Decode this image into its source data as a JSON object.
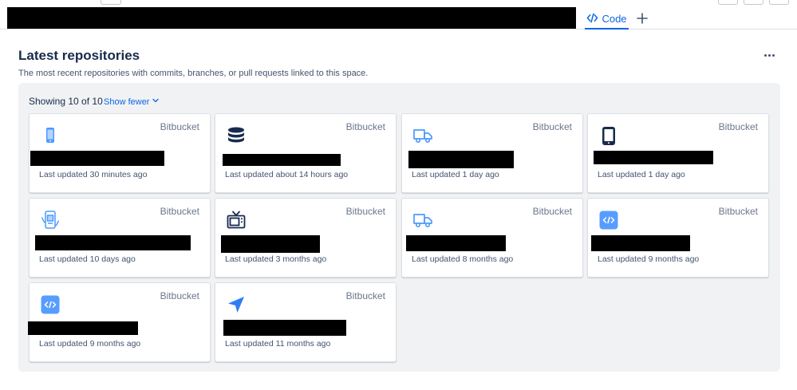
{
  "header": {
    "tabs": [
      {
        "label": "Code",
        "icon": "code-icon",
        "active": true
      }
    ],
    "add_tab_icon": "plus-icon"
  },
  "section": {
    "title": "Latest repositories",
    "description": "The most recent repositories with commits, branches, or pull requests linked to this space.",
    "more_icon": "more-horizontal-icon",
    "showing": "Showing 10 of 10",
    "show_fewer": "Show fewer"
  },
  "colors": {
    "accent": "#0c66e4",
    "panel_bg": "#f1f2f4",
    "icon_blue": "#4c9aff",
    "redaction": "#000000"
  },
  "repositories": [
    {
      "provider": "Bitbucket",
      "icon": "mobile-phone-icon",
      "updated": "Last updated 30 minutes ago"
    },
    {
      "provider": "Bitbucket",
      "icon": "database-icon",
      "updated": "Last updated about 14 hours ago"
    },
    {
      "provider": "Bitbucket",
      "icon": "truck-icon",
      "updated": "Last updated 1 day ago"
    },
    {
      "provider": "Bitbucket",
      "icon": "tablet-device-icon",
      "updated": "Last updated 1 day ago"
    },
    {
      "provider": "Bitbucket",
      "icon": "mobile-app-icon",
      "updated": "Last updated 10 days ago"
    },
    {
      "provider": "Bitbucket",
      "icon": "television-icon",
      "updated": "Last updated 3 months ago"
    },
    {
      "provider": "Bitbucket",
      "icon": "truck-icon",
      "updated": "Last updated 8 months ago"
    },
    {
      "provider": "Bitbucket",
      "icon": "code-repository-icon",
      "updated": "Last updated 9 months ago"
    },
    {
      "provider": "Bitbucket",
      "icon": "code-repository-icon",
      "updated": "Last updated 9 months ago"
    },
    {
      "provider": "Bitbucket",
      "icon": "navigation-arrow-icon",
      "updated": "Last updated 11 months ago"
    }
  ]
}
